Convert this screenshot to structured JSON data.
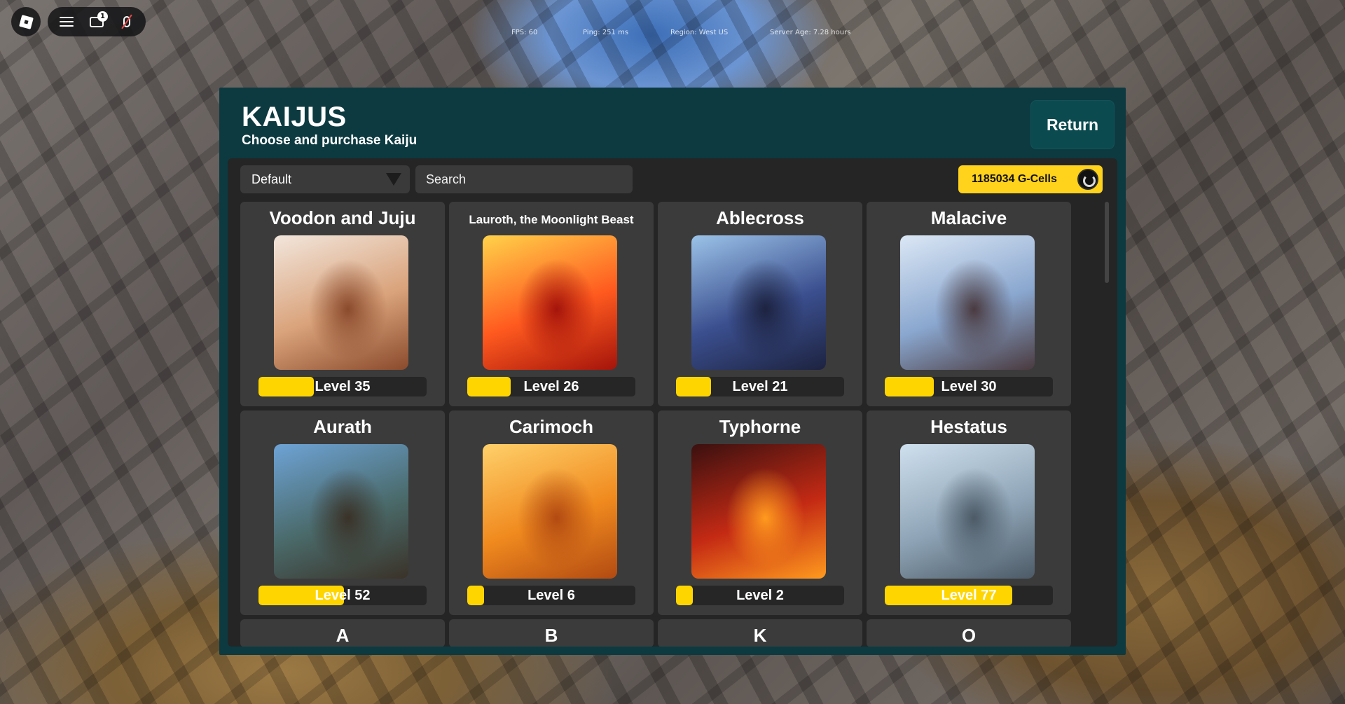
{
  "stats": {
    "fps": "FPS: 60",
    "ping": "Ping: 251 ms",
    "region": "Region: West US",
    "server_age": "Server Age: 7.28 hours"
  },
  "topbar": {
    "chat_badge": "1",
    "icons": [
      "roblox-logo-icon",
      "menu-icon",
      "chat-icon",
      "mic-muted-icon"
    ]
  },
  "panel": {
    "title": "KAIJUS",
    "subtitle": "Choose and purchase Kaiju",
    "return_label": "Return",
    "sort_selected": "Default",
    "search_placeholder": "Search",
    "currency": "1185034 G-Cells"
  },
  "kaijus": [
    {
      "name": "Voodon and Juju",
      "level": "Level 35",
      "progress": 0.33,
      "thumb": [
        "#f2e6dc",
        "#d9a27a",
        "#8a4a2c"
      ],
      "small": false
    },
    {
      "name": "Lauroth, the Moonlight Beast",
      "level": "Level 26",
      "progress": 0.26,
      "thumb": [
        "#ffd24a",
        "#ff5a1f",
        "#a4140b"
      ],
      "small": true
    },
    {
      "name": "Ablecross",
      "level": "Level 21",
      "progress": 0.21,
      "thumb": [
        "#9bc3e8",
        "#3b4f8f",
        "#1d2340"
      ],
      "small": false
    },
    {
      "name": "Malacive",
      "level": "Level 30",
      "progress": 0.29,
      "thumb": [
        "#dbe7f5",
        "#8aa7cf",
        "#4a3a3f"
      ],
      "small": false
    },
    {
      "name": "Aurath",
      "level": "Level 52",
      "progress": 0.51,
      "thumb": [
        "#6ea3d6",
        "#4a6a6a",
        "#3a3228"
      ],
      "small": false
    },
    {
      "name": "Carimoch",
      "level": "Level 6",
      "progress": 0.1,
      "thumb": [
        "#ffd06a",
        "#f08a1e",
        "#b24a12"
      ],
      "small": false
    },
    {
      "name": "Typhorne",
      "level": "Level 2",
      "progress": 0.1,
      "thumb": [
        "#3a1010",
        "#c42a14",
        "#ff9a1e"
      ],
      "small": false
    },
    {
      "name": "Hestatus",
      "level": "Level 77",
      "progress": 0.76,
      "thumb": [
        "#cfe0ee",
        "#8ea4b6",
        "#4c5a66"
      ],
      "small": false
    }
  ],
  "partial_row": [
    "A",
    "B",
    "K",
    "O"
  ],
  "colors": {
    "panel": "#0c3a40",
    "inner": "#252525",
    "card": "#3b3b3b",
    "accent": "#ffd500"
  }
}
